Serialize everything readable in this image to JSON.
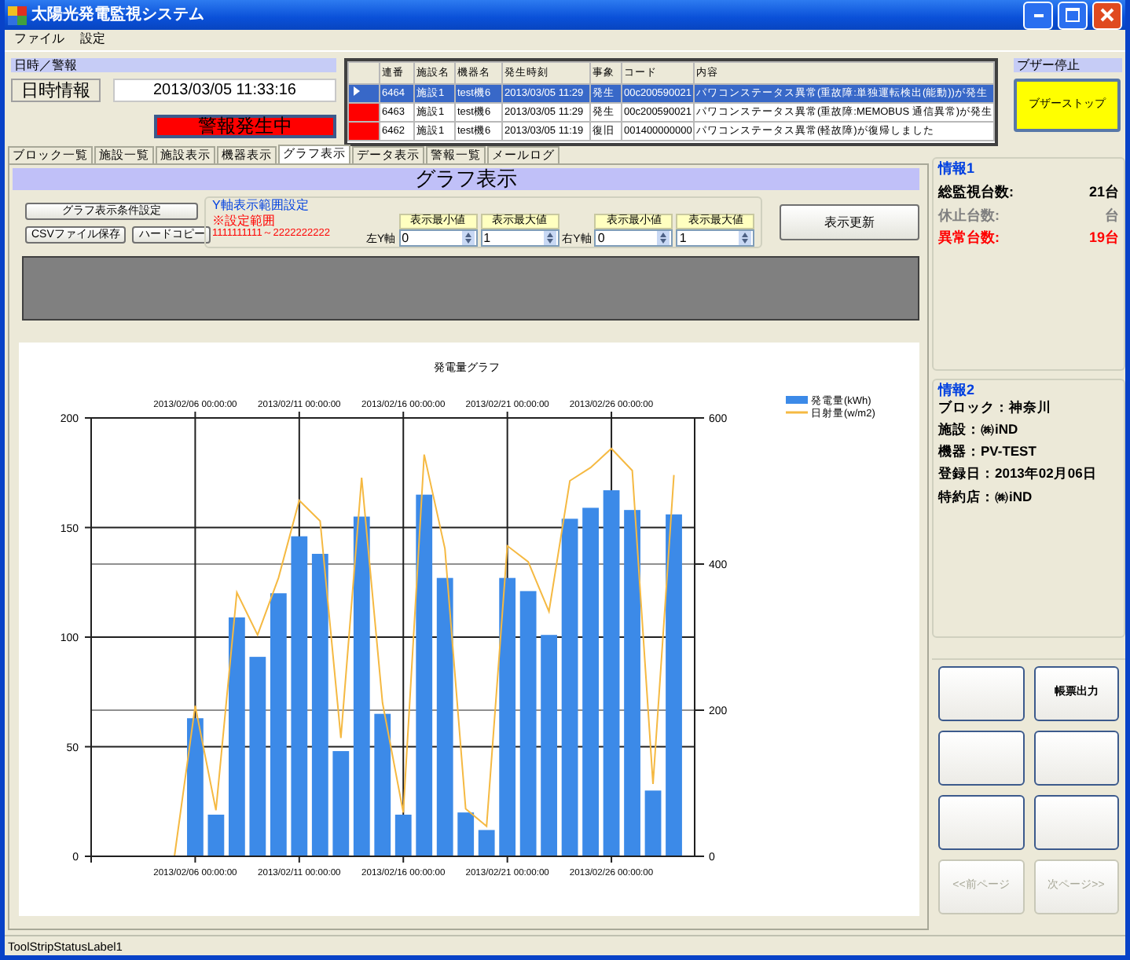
{
  "window": {
    "title": "太陽光発電監視システム"
  },
  "menu": [
    "ファイル",
    "設定"
  ],
  "datetime_panel": {
    "title": "日時／警報",
    "label": "日時情報",
    "value": "2013/03/05 11:33:16",
    "alarm": "警報発生中"
  },
  "alarm_table": {
    "columns": [
      "連番",
      "施設名",
      "機器名",
      "発生時刻",
      "事象",
      "コード",
      "内容"
    ],
    "rows": [
      {
        "selected": true,
        "cells": [
          "6464",
          "施設1",
          "test機6",
          "2013/03/05 11:29",
          "発生",
          "00c200590021",
          "パワコンステータス異常(重故障:単独運転検出(能動))が発生"
        ]
      },
      {
        "selected": false,
        "cells": [
          "6463",
          "施設1",
          "test機6",
          "2013/03/05 11:29",
          "発生",
          "00c200590021",
          "パワコンステータス異常(重故障:MEMOBUS 通信異常)が発生"
        ]
      },
      {
        "selected": false,
        "cells": [
          "6462",
          "施設1",
          "test機6",
          "2013/03/05 11:19",
          "復旧",
          "001400000000",
          "パワコンステータス異常(軽故障)が復帰しました"
        ]
      }
    ]
  },
  "buzzer": {
    "title": "ブザー停止",
    "button": "ブザーストップ"
  },
  "tabs": [
    {
      "label": "ブロック一覧",
      "selected": false
    },
    {
      "label": "施設一覧",
      "selected": false
    },
    {
      "label": "施設表示",
      "selected": false
    },
    {
      "label": "機器表示",
      "selected": false
    },
    {
      "label": "グラフ表示",
      "selected": true
    },
    {
      "label": "データ表示",
      "selected": false
    },
    {
      "label": "警報一覧",
      "selected": false
    },
    {
      "label": "メールログ",
      "selected": false
    }
  ],
  "graph_page": {
    "heading": "グラフ表示",
    "buttons": [
      "グラフ表示条件設定",
      "CSVファイル保存",
      "ハードコピー"
    ],
    "range": {
      "title": "Y軸表示範囲設定",
      "note": "※設定範囲",
      "range": "1111111111～2222222222",
      "axes": [
        {
          "label": "左Y軸",
          "min_header": "表示最小値",
          "max_header": "表示最大値",
          "min": "0",
          "max": "1"
        },
        {
          "label": "右Y軸",
          "min_header": "表示最小値",
          "max_header": "表示最大値",
          "min": "0",
          "max": "1"
        }
      ]
    },
    "refresh": "表示更新",
    "chart_data": {
      "type": "bar",
      "title": "発電量グラフ",
      "categories": [
        null,
        null,
        null,
        null,
        null,
        "2013/02/06 00:00:00",
        null,
        null,
        null,
        null,
        "2013/02/11 00:00:00",
        null,
        null,
        null,
        null,
        "2013/02/16 00:00:00",
        null,
        null,
        null,
        null,
        "2013/02/21 00:00:00",
        null,
        null,
        null,
        null,
        "2013/02/26 00:00:00",
        null,
        null,
        null,
        null
      ],
      "series": [
        {
          "name": "発電量(kWh)",
          "color": "#3c8ae8",
          "type": "bar",
          "values": [
            null,
            null,
            null,
            null,
            null,
            63,
            19,
            109,
            91,
            120,
            146,
            138,
            48,
            155,
            65,
            19,
            165,
            127,
            20,
            12,
            127,
            121,
            101,
            154,
            159,
            167,
            158,
            30,
            156,
            null
          ]
        },
        {
          "name": "日射量(w/m2)",
          "color": "#f5b942",
          "type": "line",
          "axis": "y2",
          "values": [
            null,
            null,
            null,
            null,
            0,
            206,
            63,
            361,
            303,
            381,
            487,
            459,
            162,
            518,
            210,
            60,
            550,
            421,
            65,
            41,
            425,
            403,
            335,
            514,
            532,
            558,
            528,
            99,
            522,
            null
          ]
        }
      ],
      "ylim": [
        0,
        200
      ],
      "yticks": [
        0,
        50,
        100,
        150,
        200
      ],
      "y2lim": [
        0,
        600
      ],
      "y2ticks": [
        0,
        200,
        400,
        600
      ],
      "grid": true,
      "legend": true
    }
  },
  "info1": {
    "title": "情報1",
    "rows": [
      {
        "label": "総監視台数:",
        "value": "21台",
        "color": "#000000"
      },
      {
        "label": "休止台数:",
        "value": "台",
        "color": "#808080"
      },
      {
        "label": "異常台数:",
        "value": "19台",
        "color": "#ff0000"
      }
    ]
  },
  "info2": {
    "title": "情報2",
    "lines": [
      "ブロック：神奈川",
      "施設：㈱iND",
      "機器：PV-TEST",
      "登録日：2013年02月06日",
      "特約店：㈱iND"
    ]
  },
  "buttons": [
    {
      "disabled": false
    },
    {
      "label": "帳票出力",
      "disabled": false
    },
    {
      "disabled": false
    },
    {
      "disabled": false
    },
    {
      "disabled": false
    },
    {
      "disabled": false
    },
    {
      "label": "<<前ページ",
      "disabled": true
    },
    {
      "label": "次ページ>>",
      "disabled": true
    }
  ],
  "status_bar": "ToolStripStatusLabel1"
}
